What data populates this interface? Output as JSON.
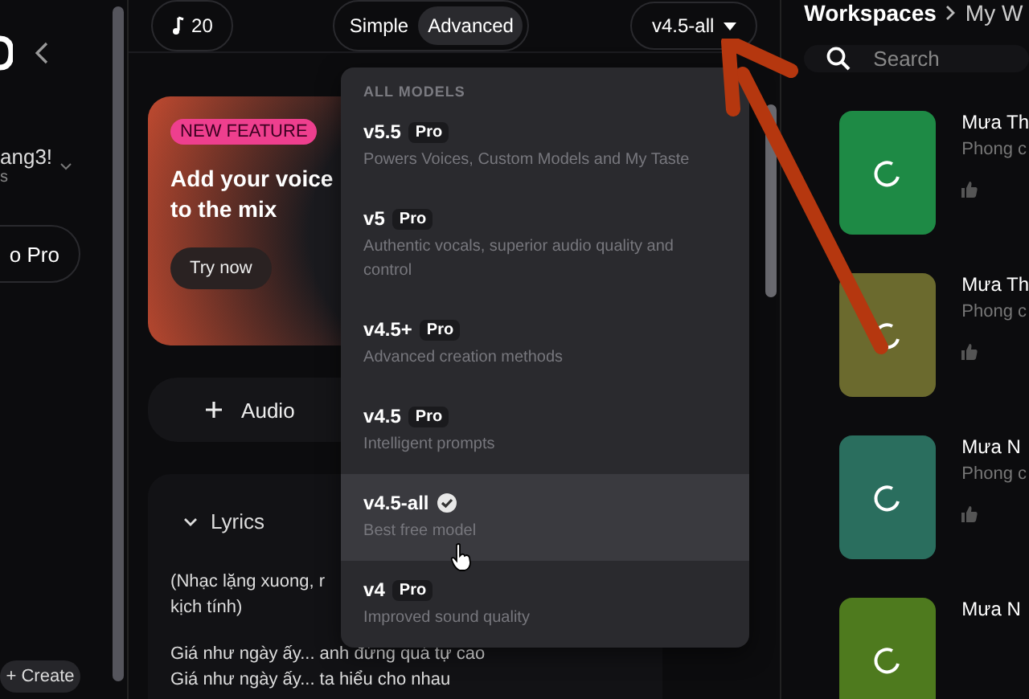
{
  "sidebar": {
    "account_name": "ang3!",
    "account_sub": "s",
    "upgrade_button": "o Pro",
    "create_button": "+ Create"
  },
  "top_bar": {
    "credits": "20",
    "modes": [
      {
        "label": "Simple",
        "selected": false
      },
      {
        "label": "Advanced",
        "selected": true
      }
    ],
    "model_button": "v4.5-all"
  },
  "promo": {
    "badge": "NEW FEATURE",
    "title": "Add your voice to the mix",
    "button": "Try now"
  },
  "audio_button": "Audio",
  "lyrics": {
    "label": "Lyrics",
    "expanded": true,
    "lines": [
      "(Nhạc lặng xuong, r",
      "kịch tính)",
      "Giá như ngày ấy... anh đứng quá tự cao",
      "Giá như ngày ấy... ta hiểu cho nhau"
    ]
  },
  "model_menu": {
    "heading": "ALL MODELS",
    "items": [
      {
        "label": "v5.5",
        "badge": "Pro",
        "description": "Powers Voices, Custom Models and My Taste",
        "selected": false
      },
      {
        "label": "v5",
        "badge": "Pro",
        "description": "Authentic vocals, superior audio quality and control",
        "selected": false
      },
      {
        "label": "v4.5+",
        "badge": "Pro",
        "description": "Advanced creation methods",
        "selected": false
      },
      {
        "label": "v4.5",
        "badge": "Pro",
        "description": "Intelligent prompts",
        "selected": false
      },
      {
        "label": "v4.5-all",
        "description": "Best free model",
        "selected": true
      },
      {
        "label": "v4",
        "badge": "Pro",
        "description": "Improved sound quality",
        "selected": false
      }
    ]
  },
  "workspace": {
    "breadcrumb": [
      "Workspaces",
      "My W"
    ],
    "search": {
      "placeholder": "Search"
    },
    "songs": [
      {
        "title": "Mưa Th",
        "subtitle": "Phong c",
        "color": "#1e8a45"
      },
      {
        "title": "Mưa Th",
        "subtitle": "Phong c",
        "color": "#6b6a2e"
      },
      {
        "title": "Mưa N",
        "subtitle": "Phong c",
        "color": "#2a6e5e"
      },
      {
        "title": "Mưa N",
        "color": "#4e7a1e"
      }
    ]
  }
}
